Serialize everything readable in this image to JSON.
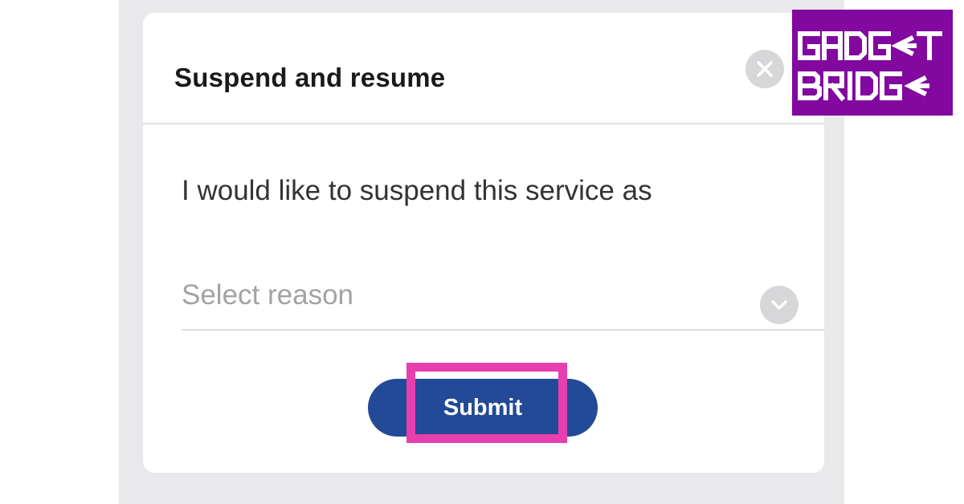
{
  "dialog": {
    "title": "Suspend and resume",
    "close_icon": "close-icon",
    "prompt": "I would like to suspend this service as",
    "select": {
      "placeholder": "Select reason",
      "icon": "chevron-down-icon"
    },
    "submit_label": "Submit"
  },
  "watermark": {
    "text": "GADGET BRIDGE"
  },
  "colors": {
    "backdrop": "#e9e9eb",
    "dialog_bg": "#ffffff",
    "button_bg": "#234a96",
    "highlight": "#e83fae",
    "logo_bg": "#82089f"
  }
}
